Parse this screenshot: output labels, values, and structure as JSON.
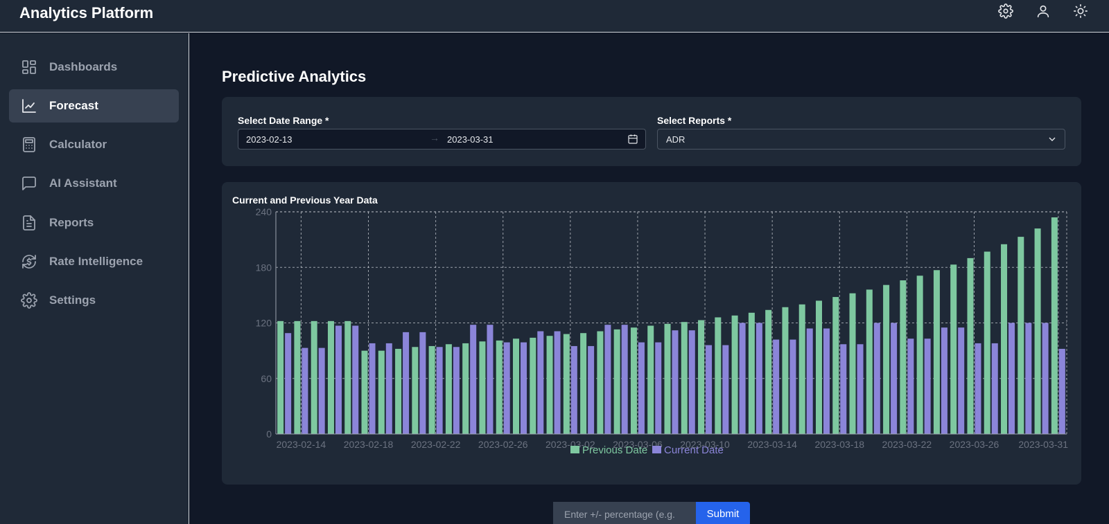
{
  "app": {
    "title": "Analytics Platform"
  },
  "header": {
    "icons": [
      "settings-gear-icon",
      "user-icon",
      "sun-icon"
    ]
  },
  "sidebar": {
    "items": [
      {
        "label": "Dashboards",
        "icon": "dashboard-grid-icon",
        "active": false
      },
      {
        "label": "Forecast",
        "icon": "line-chart-icon",
        "active": true
      },
      {
        "label": "Calculator",
        "icon": "calculator-icon",
        "active": false
      },
      {
        "label": "AI Assistant",
        "icon": "chat-bubble-icon",
        "active": false
      },
      {
        "label": "Reports",
        "icon": "report-document-icon",
        "active": false
      },
      {
        "label": "Rate Intelligence",
        "icon": "currency-refresh-icon",
        "active": false
      },
      {
        "label": "Settings",
        "icon": "settings-gear-icon",
        "active": false
      }
    ]
  },
  "main": {
    "title": "Predictive Analytics",
    "filters": {
      "date_range_label": "Select Date Range *",
      "date_start": "2023-02-13",
      "date_end": "2023-03-31",
      "arrow": "→",
      "reports_label": "Select Reports *",
      "report_selected": "ADR"
    },
    "percentage": {
      "placeholder": "Enter +/- percentage (e.g.",
      "submit_label": "Submit"
    }
  },
  "colors": {
    "previous": "#7ec8a0",
    "current": "#8b85d9",
    "background": "#111827",
    "panel": "#1f2937",
    "accent": "#2563eb"
  },
  "chart_data": {
    "type": "bar",
    "title": "Current and Previous Year Data",
    "xlabel": "",
    "ylabel": "",
    "ylim": [
      0,
      240
    ],
    "yticks": [
      0,
      60,
      120,
      180,
      240
    ],
    "xticks": [
      "2023-02-14",
      "2023-02-18",
      "2023-02-22",
      "2023-02-26",
      "2023-03-02",
      "2023-03-06",
      "2023-03-10",
      "2023-03-14",
      "2023-03-18",
      "2023-03-22",
      "2023-03-26",
      "2023-03-31"
    ],
    "grid": true,
    "legend_position": "bottom",
    "categories": [
      "2023-02-13",
      "2023-02-14",
      "2023-02-15",
      "2023-02-16",
      "2023-02-17",
      "2023-02-18",
      "2023-02-19",
      "2023-02-20",
      "2023-02-21",
      "2023-02-22",
      "2023-02-23",
      "2023-02-24",
      "2023-02-25",
      "2023-02-26",
      "2023-02-27",
      "2023-02-28",
      "2023-03-01",
      "2023-03-02",
      "2023-03-03",
      "2023-03-04",
      "2023-03-05",
      "2023-03-06",
      "2023-03-07",
      "2023-03-08",
      "2023-03-09",
      "2023-03-10",
      "2023-03-11",
      "2023-03-12",
      "2023-03-13",
      "2023-03-14",
      "2023-03-15",
      "2023-03-16",
      "2023-03-17",
      "2023-03-18",
      "2023-03-19",
      "2023-03-20",
      "2023-03-21",
      "2023-03-22",
      "2023-03-23",
      "2023-03-24",
      "2023-03-25",
      "2023-03-26",
      "2023-03-27",
      "2023-03-28",
      "2023-03-29",
      "2023-03-30",
      "2023-03-31"
    ],
    "series": [
      {
        "name": "Previous Date",
        "values": [
          122,
          122,
          122,
          122,
          122,
          90,
          90,
          92,
          94,
          95,
          97,
          98,
          100,
          101,
          103,
          104,
          106,
          108,
          109,
          111,
          113,
          115,
          117,
          119,
          121,
          123,
          126,
          128,
          131,
          134,
          137,
          140,
          144,
          148,
          152,
          156,
          161,
          166,
          171,
          177,
          183,
          190,
          197,
          205,
          213,
          222,
          234
        ]
      },
      {
        "name": "Current Date",
        "values": [
          109,
          93,
          93,
          117,
          117,
          98,
          98,
          110,
          110,
          94,
          94,
          118,
          118,
          99,
          99,
          111,
          111,
          95,
          95,
          118,
          118,
          99,
          99,
          112,
          112,
          96,
          96,
          120,
          120,
          102,
          102,
          114,
          114,
          97,
          97,
          120,
          120,
          103,
          103,
          115,
          115,
          98,
          98,
          120,
          120,
          120,
          92
        ]
      }
    ]
  }
}
